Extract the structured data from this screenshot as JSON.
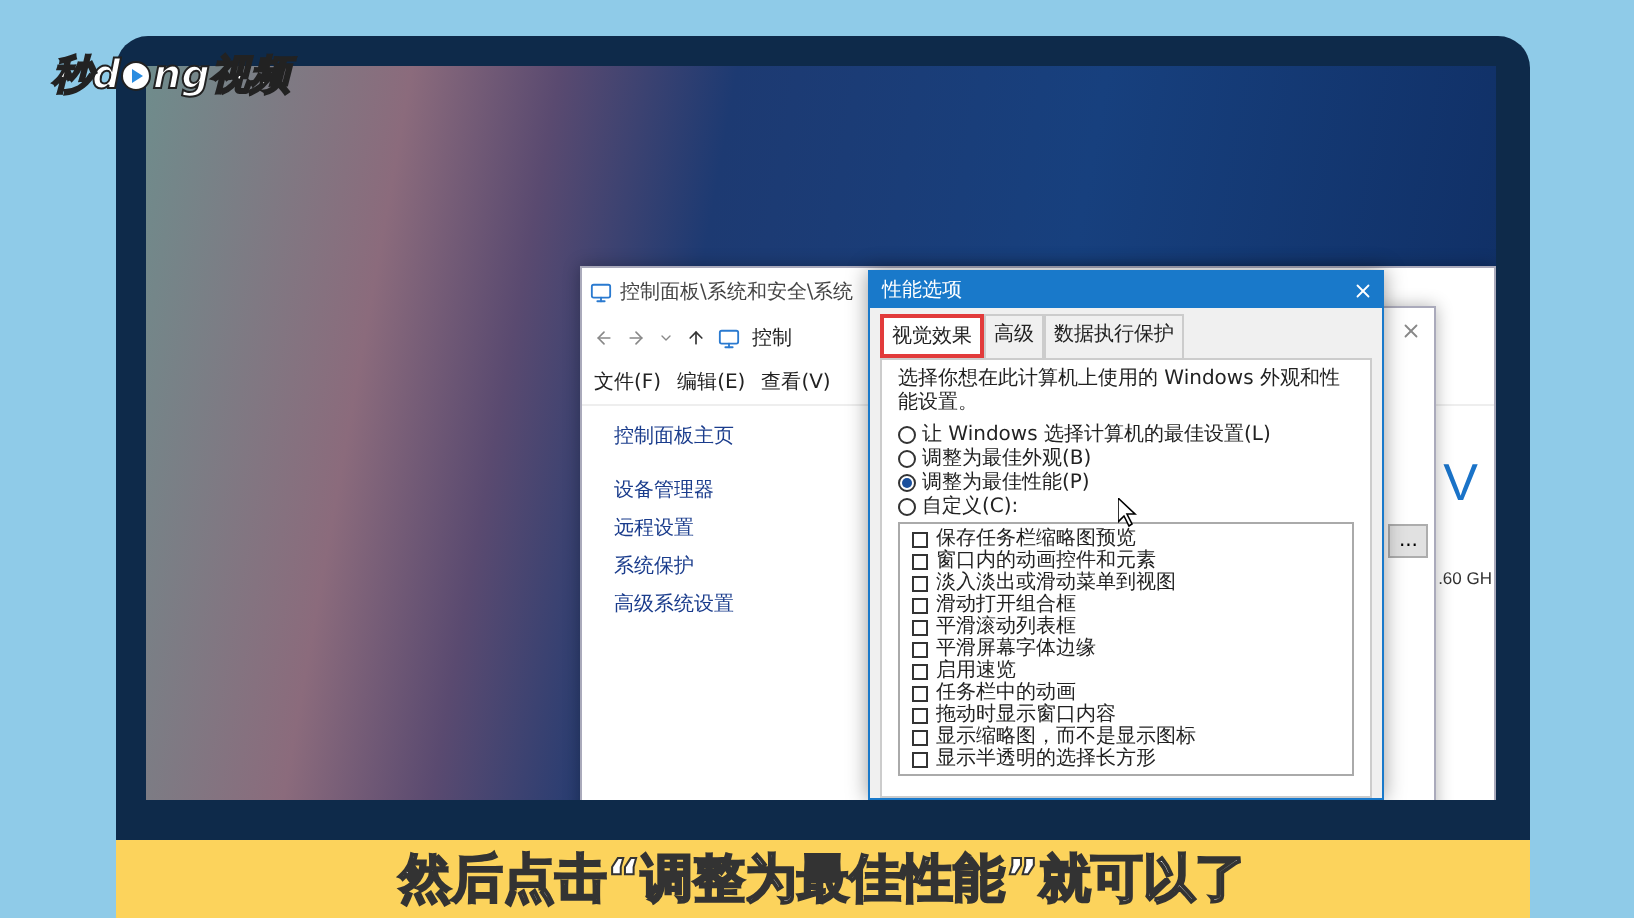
{
  "logo": {
    "before": "秒d",
    "after": "ng视频"
  },
  "explorer": {
    "title": "控制面板\\系统和安全\\系统",
    "breadcrumb": "控制",
    "menu": [
      "文件(F)",
      "编辑(E)",
      "查看(V)"
    ],
    "home_link": "控制面板主页",
    "links": [
      "设备管理器",
      "远程设置",
      "系统保护",
      "高级系统设置"
    ],
    "brand_letter": "V",
    "cpu_text": ".60 GH"
  },
  "back_window": {
    "button": "..."
  },
  "dialog": {
    "title": "性能选项",
    "tabs": [
      {
        "label": "视觉效果",
        "selected": true,
        "highlighted": true
      },
      {
        "label": "高级",
        "selected": false,
        "highlighted": false
      },
      {
        "label": "数据执行保护",
        "selected": false,
        "highlighted": false
      }
    ],
    "description": "选择你想在此计算机上使用的 Windows 外观和性能设置。",
    "options": [
      {
        "label": "让 Windows 选择计算机的最佳设置(L)",
        "selected": false
      },
      {
        "label": "调整为最佳外观(B)",
        "selected": false
      },
      {
        "label": "调整为最佳性能(P)",
        "selected": true
      },
      {
        "label": "自定义(C):",
        "selected": false
      }
    ],
    "effects": [
      {
        "label": "保存任务栏缩略图预览",
        "checked": false
      },
      {
        "label": "窗口内的动画控件和元素",
        "checked": false
      },
      {
        "label": "淡入淡出或滑动菜单到视图",
        "checked": false
      },
      {
        "label": "滑动打开组合框",
        "checked": false
      },
      {
        "label": "平滑滚动列表框",
        "checked": false
      },
      {
        "label": "平滑屏幕字体边缘",
        "checked": false
      },
      {
        "label": "启用速览",
        "checked": false
      },
      {
        "label": "任务栏中的动画",
        "checked": false
      },
      {
        "label": "拖动时显示窗口内容",
        "checked": false
      },
      {
        "label": "显示缩略图，而不是显示图标",
        "checked": false
      },
      {
        "label": "显示半透明的选择长方形",
        "checked": false
      }
    ]
  },
  "subtitle": "然后点击“调整为最佳性能”就可以了"
}
